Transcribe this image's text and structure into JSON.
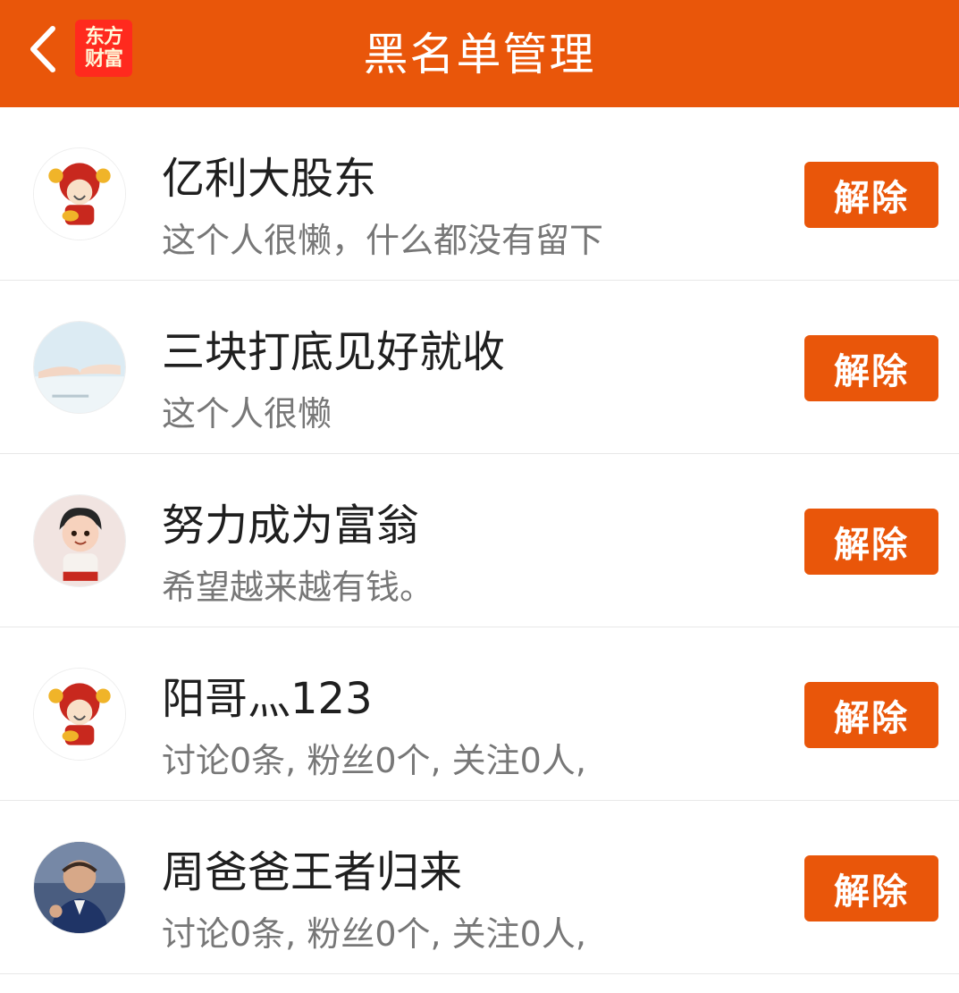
{
  "header": {
    "title": "黑名单管理",
    "logo_line1": "东方",
    "logo_line2": "财富",
    "back_icon": "chevron-left-icon"
  },
  "colors": {
    "accent": "#e9560a",
    "logo_red": "#ff2a1e",
    "name_text": "#1f1f1f",
    "desc_text": "#777777",
    "divider": "#e8e8e8"
  },
  "blacklist": [
    {
      "name": "亿利大股东",
      "desc": "这个人很懒，什么都没有留下",
      "button": "解除",
      "avatar": "god-of-wealth-avatar"
    },
    {
      "name": "三块打底见好就收",
      "desc": "这个人很懒",
      "button": "解除",
      "avatar": "holding-hands-avatar"
    },
    {
      "name": "努力成为富翁",
      "desc": "希望越来越有钱。",
      "button": "解除",
      "avatar": "cartoon-boy-avatar"
    },
    {
      "name": "阳哥灬123",
      "desc": "讨论0条, 粉丝0个, 关注0人,",
      "button": "解除",
      "avatar": "god-of-wealth-avatar"
    },
    {
      "name": "周爸爸王者归来",
      "desc": "讨论0条, 粉丝0个, 关注0人,",
      "button": "解除",
      "avatar": "man-photo-avatar"
    }
  ]
}
